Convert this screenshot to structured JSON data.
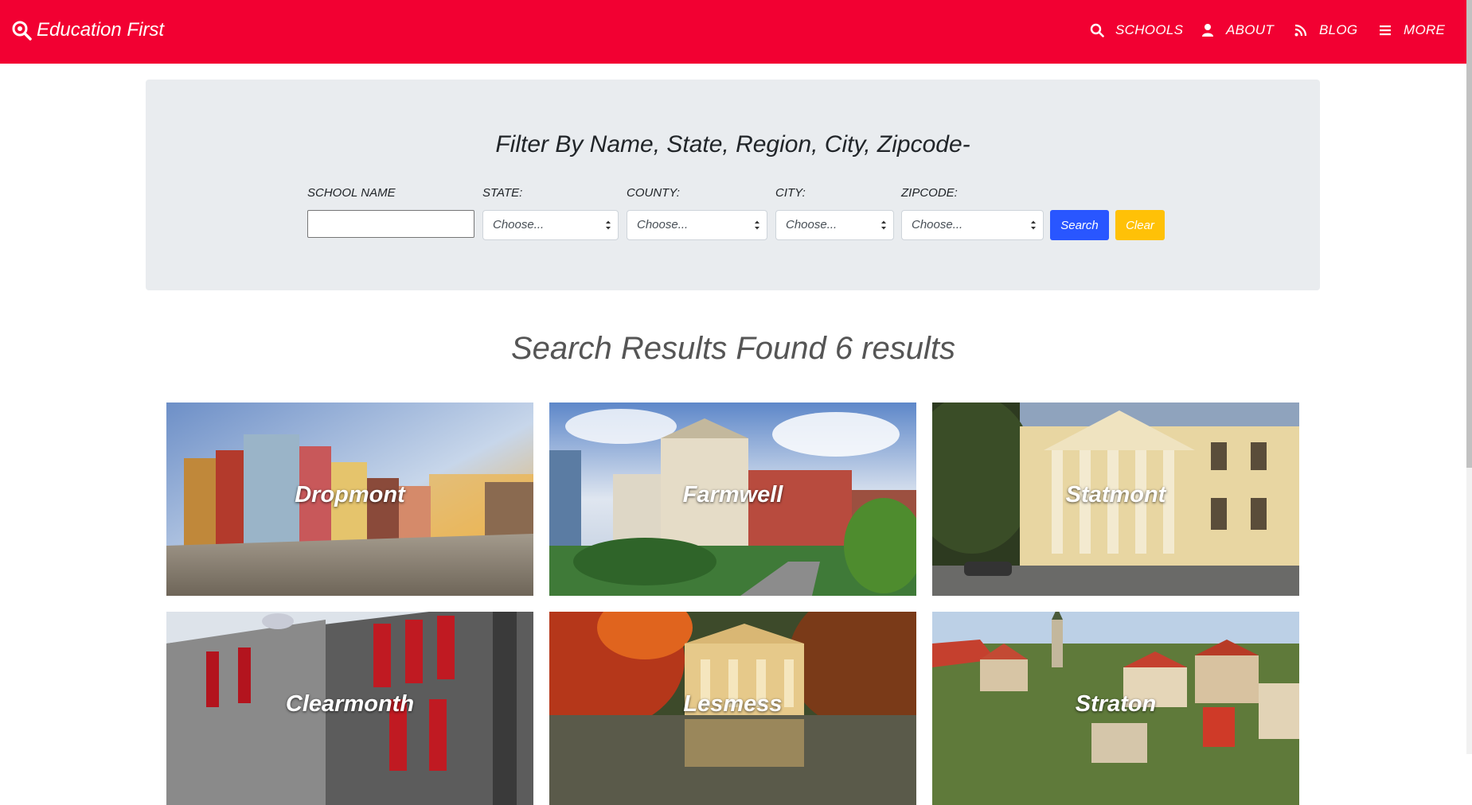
{
  "navbar": {
    "brand": "Education First",
    "brand_icon": "magnifier-icon",
    "items": [
      {
        "label": "SCHOOLS",
        "icon": "search-icon"
      },
      {
        "label": "ABOUT",
        "icon": "user-icon"
      },
      {
        "label": "BLOG",
        "icon": "rss-icon"
      },
      {
        "label": "MORE",
        "icon": "menu-icon"
      }
    ],
    "color": "#f20032"
  },
  "filter": {
    "title": "Filter By Name, State, Region, City, Zipcode-",
    "school_name_label": "SCHOOL NAME",
    "school_name_value": "",
    "state_label": "STATE:",
    "state_value": "Choose...",
    "county_label": "COUNTY:",
    "county_value": "Choose...",
    "city_label": "CITY:",
    "city_value": "Choose...",
    "zipcode_label": "ZIPCODE:",
    "zipcode_value": "Choose...",
    "search_label": "Search",
    "clear_label": "Clear",
    "search_color": "#2956ff",
    "clear_color": "#ffc107"
  },
  "results": {
    "heading": "Search Results Found 6 results",
    "cards": [
      {
        "name": "Dropmont"
      },
      {
        "name": "Farmwell"
      },
      {
        "name": "Statmont"
      },
      {
        "name": "Clearmonth"
      },
      {
        "name": "Lesmess"
      },
      {
        "name": "Straton"
      }
    ]
  }
}
